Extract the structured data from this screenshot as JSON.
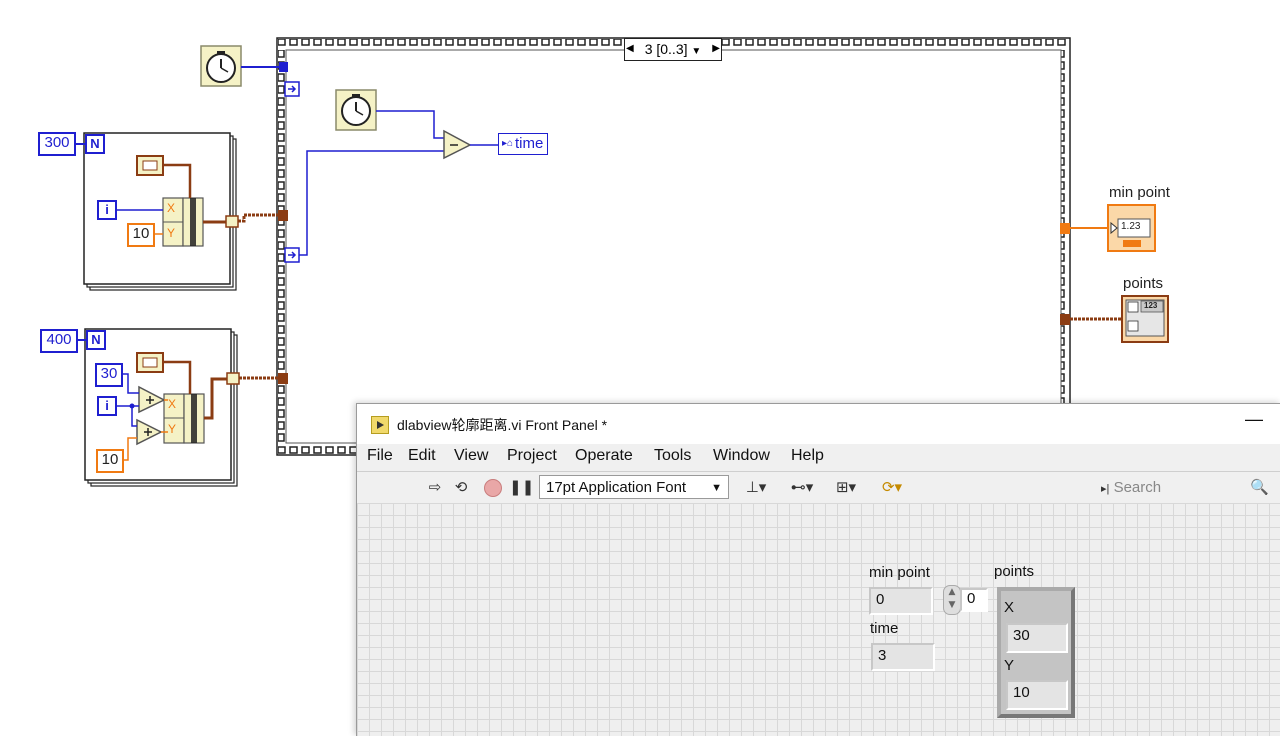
{
  "block_diagram": {
    "loop1": {
      "count": "300",
      "n_terminal": "N",
      "i_terminal": "i",
      "y_const": "10",
      "x_elem": "X",
      "y_elem": "Y"
    },
    "loop2": {
      "count": "400",
      "n_terminal": "N",
      "i_terminal": "i",
      "mult_const": "30",
      "y_const": "10",
      "x_elem": "X",
      "y_elem": "Y"
    },
    "sequence_selector": "3 [0..3]",
    "time_local": "time",
    "min_point_label": "min point",
    "min_point_indicator_text": "1.23",
    "points_label": "points",
    "points_indicator_text": "123",
    "wire_colors": {
      "numeric_blue": "#1f1fd0",
      "cluster_brown": "#8b3c13",
      "orange": "#f07a12"
    }
  },
  "front_panel": {
    "title": "dlabview轮廓距离.vi Front Panel *",
    "minimize_glyph": "—",
    "menu": [
      "File",
      "Edit",
      "View",
      "Project",
      "Operate",
      "Tools",
      "Window",
      "Help"
    ],
    "toolbar": {
      "run_icon": "run-arrow-icon",
      "run_continuous_icon": "run-continuously-icon",
      "abort_icon": "abort-icon",
      "pause_icon": "pause-icon",
      "font_selector": "17pt Application Font",
      "align_icon": "align-objects-icon",
      "distribute_icon": "distribute-objects-icon",
      "resize_icon": "resize-objects-icon",
      "reorder_icon": "reorder-icon"
    },
    "search_placeholder": "Search",
    "controls": {
      "min_point": {
        "label": "min point",
        "value": "0"
      },
      "time": {
        "label": "time",
        "value": "3"
      },
      "array_index": "0",
      "points": {
        "label": "points",
        "x_label": "X",
        "x_value": "30",
        "y_label": "Y",
        "y_value": "10"
      }
    }
  }
}
